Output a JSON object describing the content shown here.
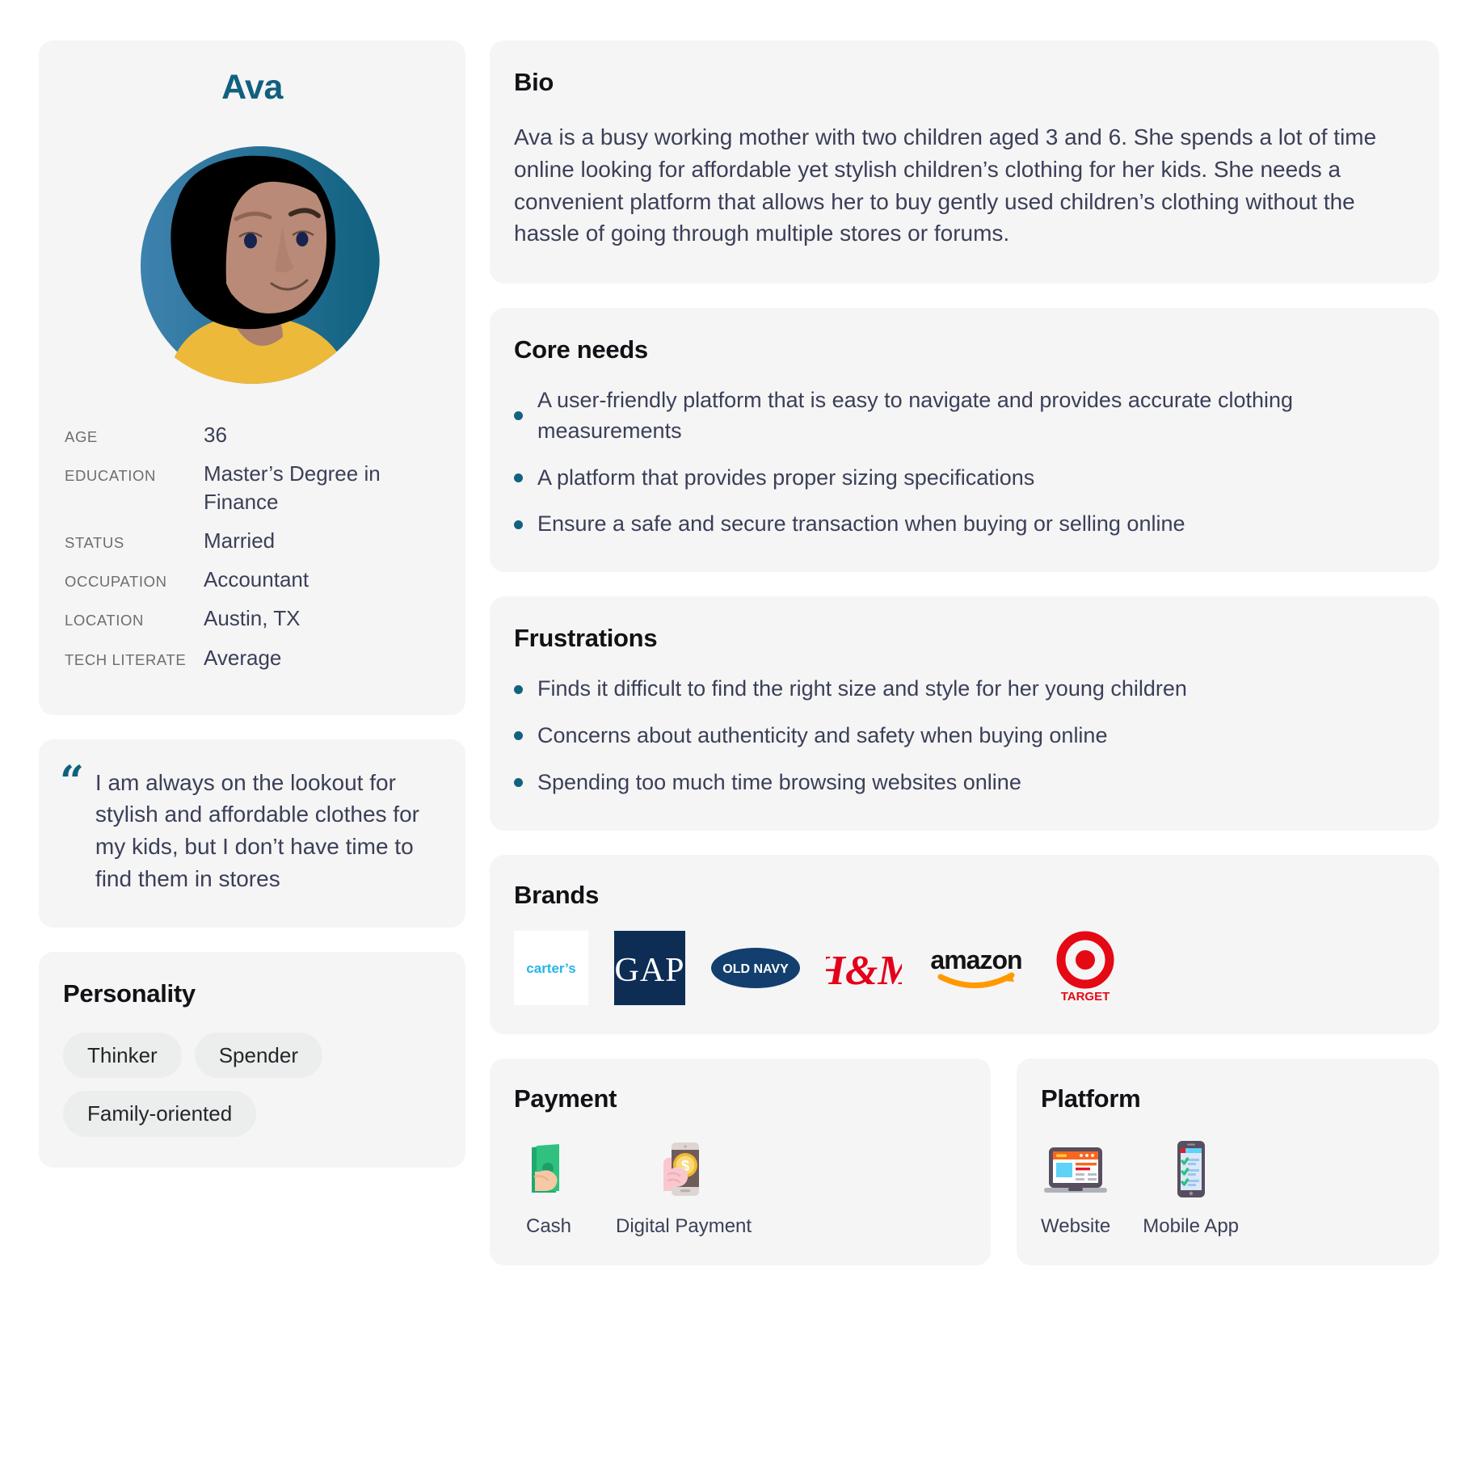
{
  "persona": {
    "name": "Ava",
    "avatar_icon": "woman-avatar-illustration",
    "attributes": [
      {
        "label": "Age",
        "value": "36"
      },
      {
        "label": "Education",
        "value": "Master’s Degree in Finance"
      },
      {
        "label": "Status",
        "value": "Married"
      },
      {
        "label": "Occupation",
        "value": "Accountant"
      },
      {
        "label": "Location",
        "value": "Austin, TX"
      },
      {
        "label": "Tech Literate",
        "value": "Average"
      }
    ]
  },
  "quote": {
    "mark": "“",
    "text": "I am always on the lookout for stylish and affordable clothes for my kids, but I don’t have time to find them in stores"
  },
  "personality": {
    "title": "Personality",
    "traits": [
      "Thinker",
      "Spender",
      "Family-oriented"
    ]
  },
  "bio": {
    "title": "Bio",
    "text": "Ava is a busy working mother with two children aged 3 and 6. She spends a lot of time online looking for affordable yet stylish children’s clothing for her kids. She needs a convenient platform that allows her to buy gently used children’s clothing without the hassle of going through multiple stores or forums."
  },
  "core_needs": {
    "title": "Core needs",
    "items": [
      "A user-friendly platform that is easy to navigate and provides accurate clothing measurements",
      "A platform that provides proper sizing specifications",
      "Ensure a safe and secure transaction when buying or selling online"
    ]
  },
  "frustrations": {
    "title": "Frustrations",
    "items": [
      "Finds it difficult to find the right size and style for her young children",
      "Concerns about authenticity and safety when buying online",
      "Spending too much time browsing websites online"
    ]
  },
  "brands": {
    "title": "Brands",
    "items": [
      {
        "name": "carter's",
        "icon": "carters-logo"
      },
      {
        "name": "GAP",
        "icon": "gap-logo"
      },
      {
        "name": "OLD NAVY",
        "icon": "old-navy-logo"
      },
      {
        "name": "H&M",
        "icon": "hm-logo"
      },
      {
        "name": "amazon",
        "icon": "amazon-logo"
      },
      {
        "name": "TARGET",
        "icon": "target-logo"
      }
    ]
  },
  "payment": {
    "title": "Payment",
    "items": [
      {
        "label": "Cash",
        "icon": "cash-in-hand-icon"
      },
      {
        "label": "Digital Payment",
        "icon": "mobile-payment-icon"
      }
    ]
  },
  "platform": {
    "title": "Platform",
    "items": [
      {
        "label": "Website",
        "icon": "laptop-website-icon"
      },
      {
        "label": "Mobile App",
        "icon": "mobile-app-icon"
      }
    ]
  },
  "colors": {
    "accent": "#11607f",
    "card_bg": "#f5f5f5",
    "body_text": "#3b3f58",
    "label_text": "#6d6d72",
    "chip_bg": "#eceded",
    "shirt_yellow": "#edb93a",
    "avatar_blue_light": "#3d82ae",
    "avatar_blue_dark": "#11607f",
    "skin": "#b98a77",
    "hair": "#000000"
  }
}
